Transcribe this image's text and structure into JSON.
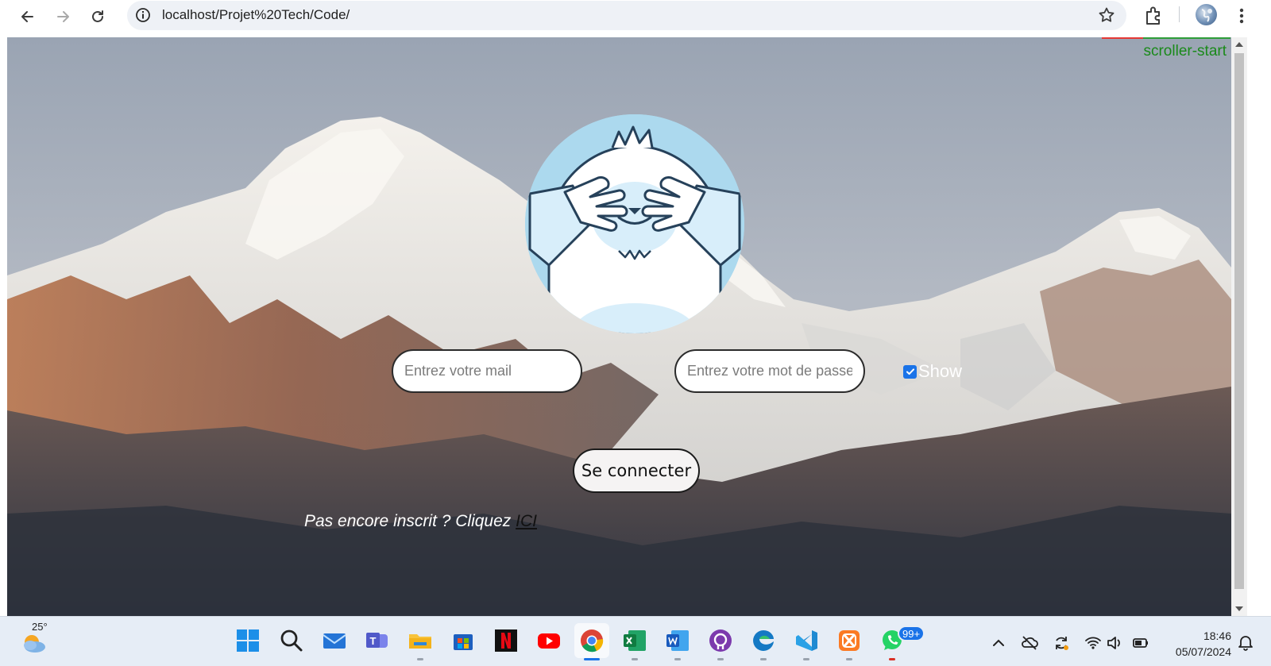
{
  "browser": {
    "url": "localhost/Projet%20Tech/Code/"
  },
  "page": {
    "scroller_label": "scroller-start",
    "email_placeholder": "Entrez votre mail",
    "password_placeholder": "Entrez votre mot de passe",
    "show_label": "Show",
    "show_checked": true,
    "login_button": "Se connecter",
    "signup_text": "Pas encore inscrit ? Cliquez ",
    "signup_link": "ICI"
  },
  "taskbar": {
    "weather_temp": "25°",
    "apps": [
      "start",
      "search",
      "mail",
      "teams",
      "file-explorer",
      "store",
      "netflix",
      "youtube",
      "chrome",
      "excel",
      "word",
      "github-desktop",
      "edge",
      "vscode",
      "xampp",
      "whatsapp"
    ],
    "whatsapp_badge": "99+",
    "time": "18:46",
    "date": "05/07/2024"
  },
  "colors": {
    "accent": "#1a73e8",
    "scroller_label": "#1a8a1a"
  }
}
